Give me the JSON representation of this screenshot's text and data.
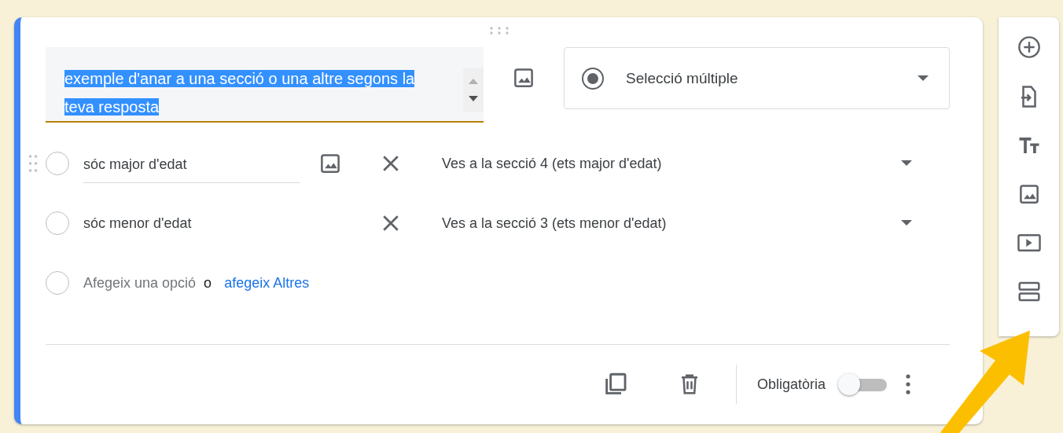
{
  "question": {
    "title": "exemple d'anar a una secció o una altre segons la teva resposta",
    "title_selected": true,
    "type": "Selecció múltiple"
  },
  "options": [
    {
      "label": "sóc major d'edat",
      "checked": false,
      "focused": true,
      "go_to": "Ves a la secció 4 (ets major d'edat)"
    },
    {
      "label": "sóc menor d'edat",
      "checked": false,
      "focused": false,
      "go_to": "Ves a la secció 3 (ets menor d'edat)"
    }
  ],
  "add_option": {
    "checked": false,
    "placeholder": "Afegeix una opció",
    "separator": "o",
    "link": "afegeix Altres"
  },
  "footer": {
    "required_label": "Obligatòria",
    "required": false
  }
}
